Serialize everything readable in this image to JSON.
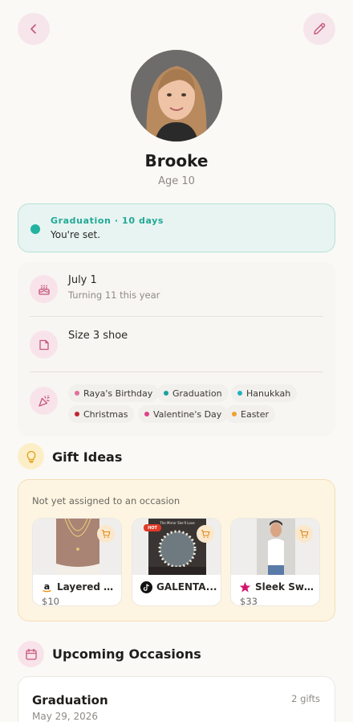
{
  "header": {
    "back_icon": "chevron-left-icon",
    "edit_icon": "pencil-icon"
  },
  "profile": {
    "name": "Brooke",
    "age": "Age 10"
  },
  "banner": {
    "title": "Graduation · 10 days",
    "subtitle": "You're set.",
    "color": "#22b2a0"
  },
  "details": {
    "birthday": {
      "icon": "cake-icon",
      "title": "July 1",
      "subtitle": "Turning 11 this year"
    },
    "sizes": {
      "icon": "note-icon",
      "title": "Size 3 shoe"
    },
    "occasions": {
      "icon": "party-popper-icon",
      "chips": [
        {
          "label": "Raya's Birthday",
          "color": "#e0709a"
        },
        {
          "label": "Graduation",
          "color": "#1aa0a0"
        },
        {
          "label": "Hanukkah",
          "color": "#22b2c0"
        },
        {
          "label": "Christmas",
          "color": "#c0262d"
        },
        {
          "label": "Valentine's Day",
          "color": "#e0408a"
        },
        {
          "label": "Easter",
          "color": "#f0a030"
        }
      ]
    }
  },
  "gift_ideas": {
    "title": "Gift Ideas",
    "icon": "lightbulb-icon",
    "caption": "Not yet assigned to an occasion",
    "items": [
      {
        "name": "Layered G...",
        "price": "$10",
        "brand": "amazon-icon"
      },
      {
        "name": "GALENTA...",
        "price": "",
        "brand": "tiktok-icon",
        "badge": "HOT",
        "thumb_text": "The Mirror She'll Love"
      },
      {
        "name": "Sleek Swe...",
        "price": "$33",
        "brand": "walmart-star-icon"
      }
    ]
  },
  "upcoming": {
    "title": "Upcoming Occasions",
    "icon": "calendar-icon",
    "items": [
      {
        "name": "Graduation",
        "date": "May 29, 2026",
        "count": "2 gifts"
      }
    ]
  }
}
